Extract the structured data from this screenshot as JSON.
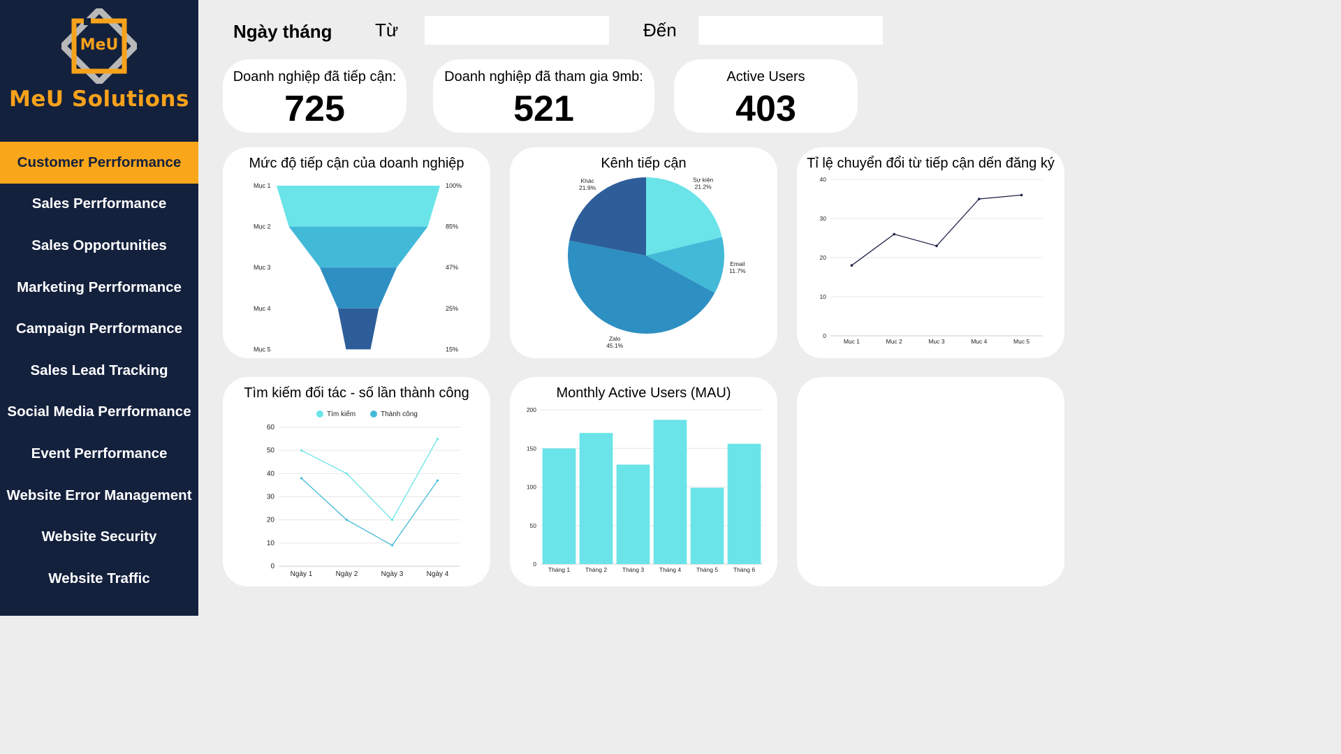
{
  "brand": {
    "mark": "MeU",
    "name": "MeU Solutions"
  },
  "nav": [
    {
      "label": "Customer Perrformance",
      "active": true
    },
    {
      "label": "Sales Perrformance"
    },
    {
      "label": "Sales Opportunities"
    },
    {
      "label": "Marketing Perrformance"
    },
    {
      "label": "Campaign Perrformance"
    },
    {
      "label": "Sales Lead Tracking"
    },
    {
      "label": "Social Media Perrformance"
    },
    {
      "label": "Event Perrformance"
    },
    {
      "label": "Website Error Management"
    },
    {
      "label": "Website Security"
    },
    {
      "label": "Website Traffic"
    }
  ],
  "filter": {
    "label": "Ngày tháng",
    "from_label": "Từ",
    "to_label": "Đến",
    "from_value": "",
    "to_value": ""
  },
  "kpis": [
    {
      "label": "Doanh nghiệp đã tiếp cận:",
      "value": "725"
    },
    {
      "label": "Doanh nghiệp đã tham gia 9mb:",
      "value": "521"
    },
    {
      "label": "Active Users",
      "value": "403"
    }
  ],
  "colors": {
    "sidebar": "#14213d",
    "accent": "#f9a61a",
    "c1": "#6ae4e8",
    "c2": "#43b9d8",
    "c3": "#2e8fc2",
    "c4": "#2d5e9a",
    "line": "#1c2145"
  },
  "chart_data": [
    {
      "type": "funnel",
      "title": "Mức độ tiếp cận của doanh nghiệp",
      "categories": [
        "Mục 1",
        "Mục 2",
        "Mục 3",
        "Mục 4",
        "Mục 5"
      ],
      "values": [
        100,
        85,
        47,
        25,
        15
      ],
      "value_labels": [
        "100%",
        "85%",
        "47%",
        "25%",
        "15%"
      ]
    },
    {
      "type": "pie",
      "title": "Kênh tiếp cận",
      "slices": [
        {
          "label": "Sự kiện",
          "value": 21.2,
          "display": "21.2%"
        },
        {
          "label": "Email",
          "value": 11.7,
          "display": "11.7%"
        },
        {
          "label": "Zalo",
          "value": 45.1,
          "display": "45.1%"
        },
        {
          "label": "Khác",
          "value": 21.9,
          "display": "21.9%"
        }
      ]
    },
    {
      "type": "line",
      "title": "Tỉ lệ chuyển đổi từ tiếp cận dến đăng ký",
      "categories": [
        "Mục 1",
        "Mục 2",
        "Mục 3",
        "Mục 4",
        "Mục 5"
      ],
      "values": [
        18,
        26,
        23,
        35,
        36
      ],
      "ylim": [
        0,
        40
      ],
      "yticks": [
        0,
        10,
        20,
        30,
        40
      ],
      "grid": true
    },
    {
      "type": "line",
      "title": "Tìm kiếm đối tác - số lần thành công",
      "categories": [
        "Ngày 1",
        "Ngày 2",
        "Ngày 3",
        "Ngày 4"
      ],
      "series": [
        {
          "name": "Tìm kiếm",
          "values": [
            50,
            40,
            20,
            55
          ]
        },
        {
          "name": "Thành công",
          "values": [
            38,
            20,
            9,
            37
          ]
        }
      ],
      "ylim": [
        0,
        60
      ],
      "yticks": [
        0,
        10,
        20,
        30,
        40,
        50,
        60
      ],
      "legend": "top-center",
      "grid": true
    },
    {
      "type": "bar",
      "title": "Monthly Active Users (MAU)",
      "categories": [
        "Tháng 1",
        "Tháng 2",
        "Tháng 3",
        "Tháng 4",
        "Tháng 5",
        "Tháng 6"
      ],
      "values": [
        150,
        170,
        129,
        187,
        99,
        156
      ],
      "ylim": [
        0,
        200
      ],
      "yticks": [
        0,
        50,
        100,
        150,
        200
      ],
      "grid": true
    }
  ]
}
